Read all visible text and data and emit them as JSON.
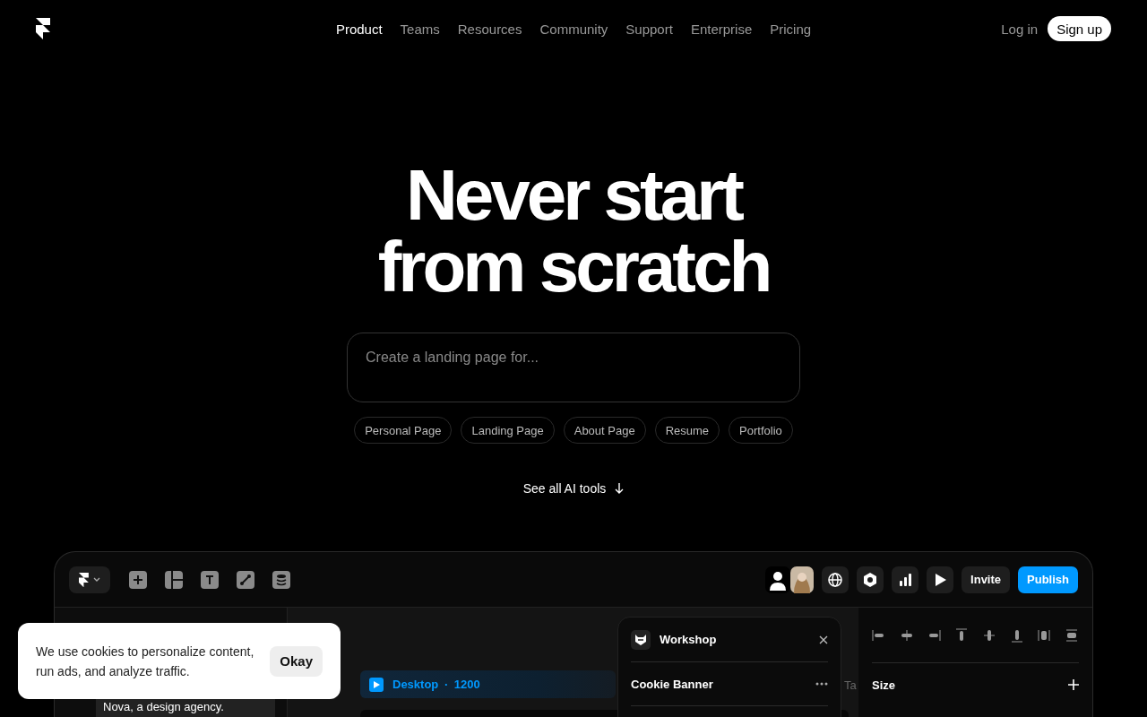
{
  "nav": {
    "links": [
      {
        "label": "Product",
        "selected": true
      },
      {
        "label": "Teams",
        "selected": false
      },
      {
        "label": "Resources",
        "selected": false
      },
      {
        "label": "Community",
        "selected": false
      },
      {
        "label": "Support",
        "selected": false
      },
      {
        "label": "Enterprise",
        "selected": false
      },
      {
        "label": "Pricing",
        "selected": false
      }
    ],
    "login": "Log in",
    "signup": "Sign up"
  },
  "hero": {
    "title_lines": [
      "Never start",
      "from scratch"
    ],
    "prompt": {
      "placeholder": "Create a landing page for..."
    },
    "chips": [
      "Personal Page",
      "Landing Page",
      "About Page",
      "Resume",
      "Portfolio"
    ],
    "see_all": "See all AI tools"
  },
  "app": {
    "buttons": [
      "Invite",
      "Publish"
    ],
    "prompt_card": "Nova, a design agency.",
    "breakpoint": "Desktop · 1200",
    "canvas_fragment": "Ta",
    "panel": {
      "title": "Workshop",
      "item": "Cookie Banner"
    },
    "properties": {
      "section": "Size"
    }
  },
  "cookie": {
    "message": "We use cookies to personalize content, run ads, and analyze traffic.",
    "button": "Okay"
  }
}
